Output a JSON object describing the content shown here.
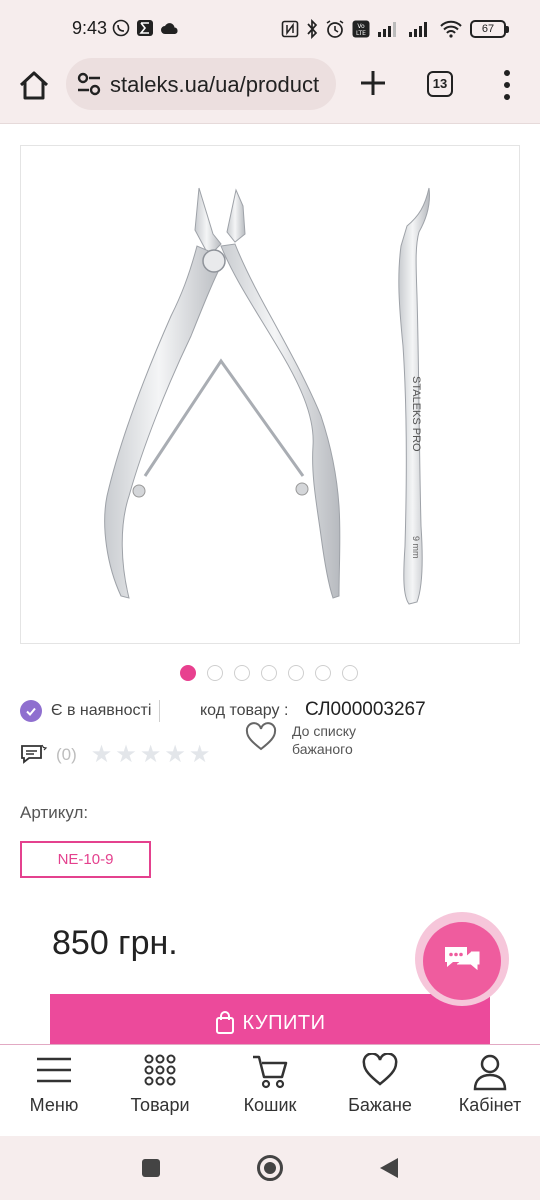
{
  "status_bar": {
    "time": "9:43",
    "battery": "67"
  },
  "browser": {
    "url": "staleks.ua/ua/product",
    "tab_count": "13"
  },
  "gallery": {
    "dot_count": 7,
    "active_index": 0,
    "product_engraving": "STALEKS PRO",
    "product_engraving_2": "9 mm"
  },
  "product": {
    "availability": "Є в наявності",
    "code_label": "код товару :",
    "code_value": "СЛ000003267",
    "review_count": "(0)",
    "rating_stars": 5,
    "wishlist_label": "До списку бажаного",
    "article_label": "Артикул:",
    "article_value": "NE-10-9",
    "price": "850 грн.",
    "buy_label": "КУПИТИ"
  },
  "site_nav": {
    "items": [
      {
        "label": "Меню",
        "icon": "hamburger-icon"
      },
      {
        "label": "Товари",
        "icon": "grid-icon"
      },
      {
        "label": "Кошик",
        "icon": "cart-icon"
      },
      {
        "label": "Бажане",
        "icon": "heart-icon"
      },
      {
        "label": "Кабінет",
        "icon": "user-icon"
      }
    ]
  },
  "colors": {
    "accent": "#ec4a9b",
    "check": "#8f6fcf",
    "browser_bg": "#f6eded"
  }
}
